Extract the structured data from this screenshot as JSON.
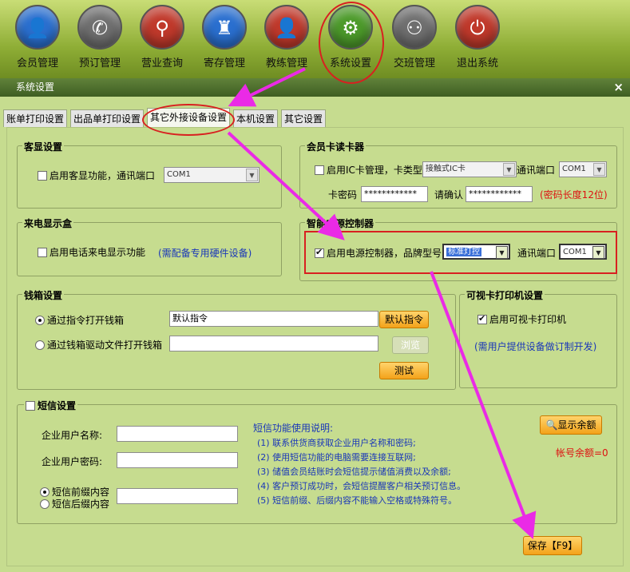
{
  "toolbar": {
    "items": [
      {
        "label": "会员管理",
        "icon": "member-icon",
        "color": "#2a6fcf"
      },
      {
        "label": "预订管理",
        "icon": "phone-icon",
        "color": "#6f6f6f"
      },
      {
        "label": "营业查询",
        "icon": "search-icon",
        "color": "#c0392b"
      },
      {
        "label": "寄存管理",
        "icon": "bag-icon",
        "color": "#2a6fcf"
      },
      {
        "label": "教练管理",
        "icon": "coach-icon",
        "color": "#c0392b"
      },
      {
        "label": "系统设置",
        "icon": "gear-icon",
        "color": "#4c9a2a"
      },
      {
        "label": "交班管理",
        "icon": "handover-icon",
        "color": "#6f6f6f"
      },
      {
        "label": "退出系统",
        "icon": "power-icon",
        "color": "#c0392b"
      }
    ]
  },
  "window": {
    "title": "系统设置",
    "close": "×"
  },
  "tabs": [
    "账单打印设置",
    "出品单打印设置",
    "其它外接设备设置",
    "本机设置",
    "其它设置"
  ],
  "customer_display": {
    "title": "客显设置",
    "enable_label": "启用客显功能，通讯端口",
    "port": "COM1"
  },
  "card_reader": {
    "title": "会员卡读卡器",
    "enable_label": "启用IC卡管理，卡类型",
    "card_type": "接触式IC卡",
    "port_label": "通讯端口",
    "port": "COM1",
    "pwd_label": "卡密码",
    "pwd_value": "************",
    "confirm_label": "请确认",
    "confirm_value": "************",
    "pwd_note": "(密码长度12位)"
  },
  "caller_id": {
    "title": "来电显示盒",
    "enable_label": "启用电话来电显示功能",
    "note": "(需配备专用硬件设备)"
  },
  "power_controller": {
    "title": "智能电源控制器",
    "enable_label": "启用电源控制器，品牌型号",
    "brand": "标准灯控",
    "port_label": "通讯端口",
    "port": "COM1"
  },
  "cash_drawer": {
    "title": "钱箱设置",
    "option1_label": "通过指令打开钱箱",
    "command_value": "默认指令",
    "default_cmd_button": "默认指令",
    "option2_label": "通过钱箱驱动文件打开钱箱",
    "browse_button": "浏览",
    "test_button": "测试"
  },
  "visual_card_printer": {
    "title": "可视卡打印机设置",
    "enable_label": "启用可视卡打印机",
    "note": "(需用户提供设备做订制开发)"
  },
  "sms": {
    "title": "短信设置",
    "company_name_label": "企业用户名称:",
    "company_pwd_label": "企业用户密码:",
    "prefix_label": "短信前缀内容",
    "suffix_label": "短信后缀内容",
    "instructions_title": "短信功能使用说明:",
    "instructions": [
      "(1) 联系供货商获取企业用户名称和密码;",
      "(2) 使用短信功能的电脑需要连接互联网;",
      "(3) 储值会员结账时会短信提示储值消费以及余额;",
      "(4) 客户预订成功时，会短信提醒客户相关预订信息。",
      "(5) 短信前缀、后缀内容不能输入空格或特殊符号。"
    ],
    "balance_button": "显示余额",
    "balance_label": "帐号余额=0"
  },
  "save_button": "保存【F9】"
}
